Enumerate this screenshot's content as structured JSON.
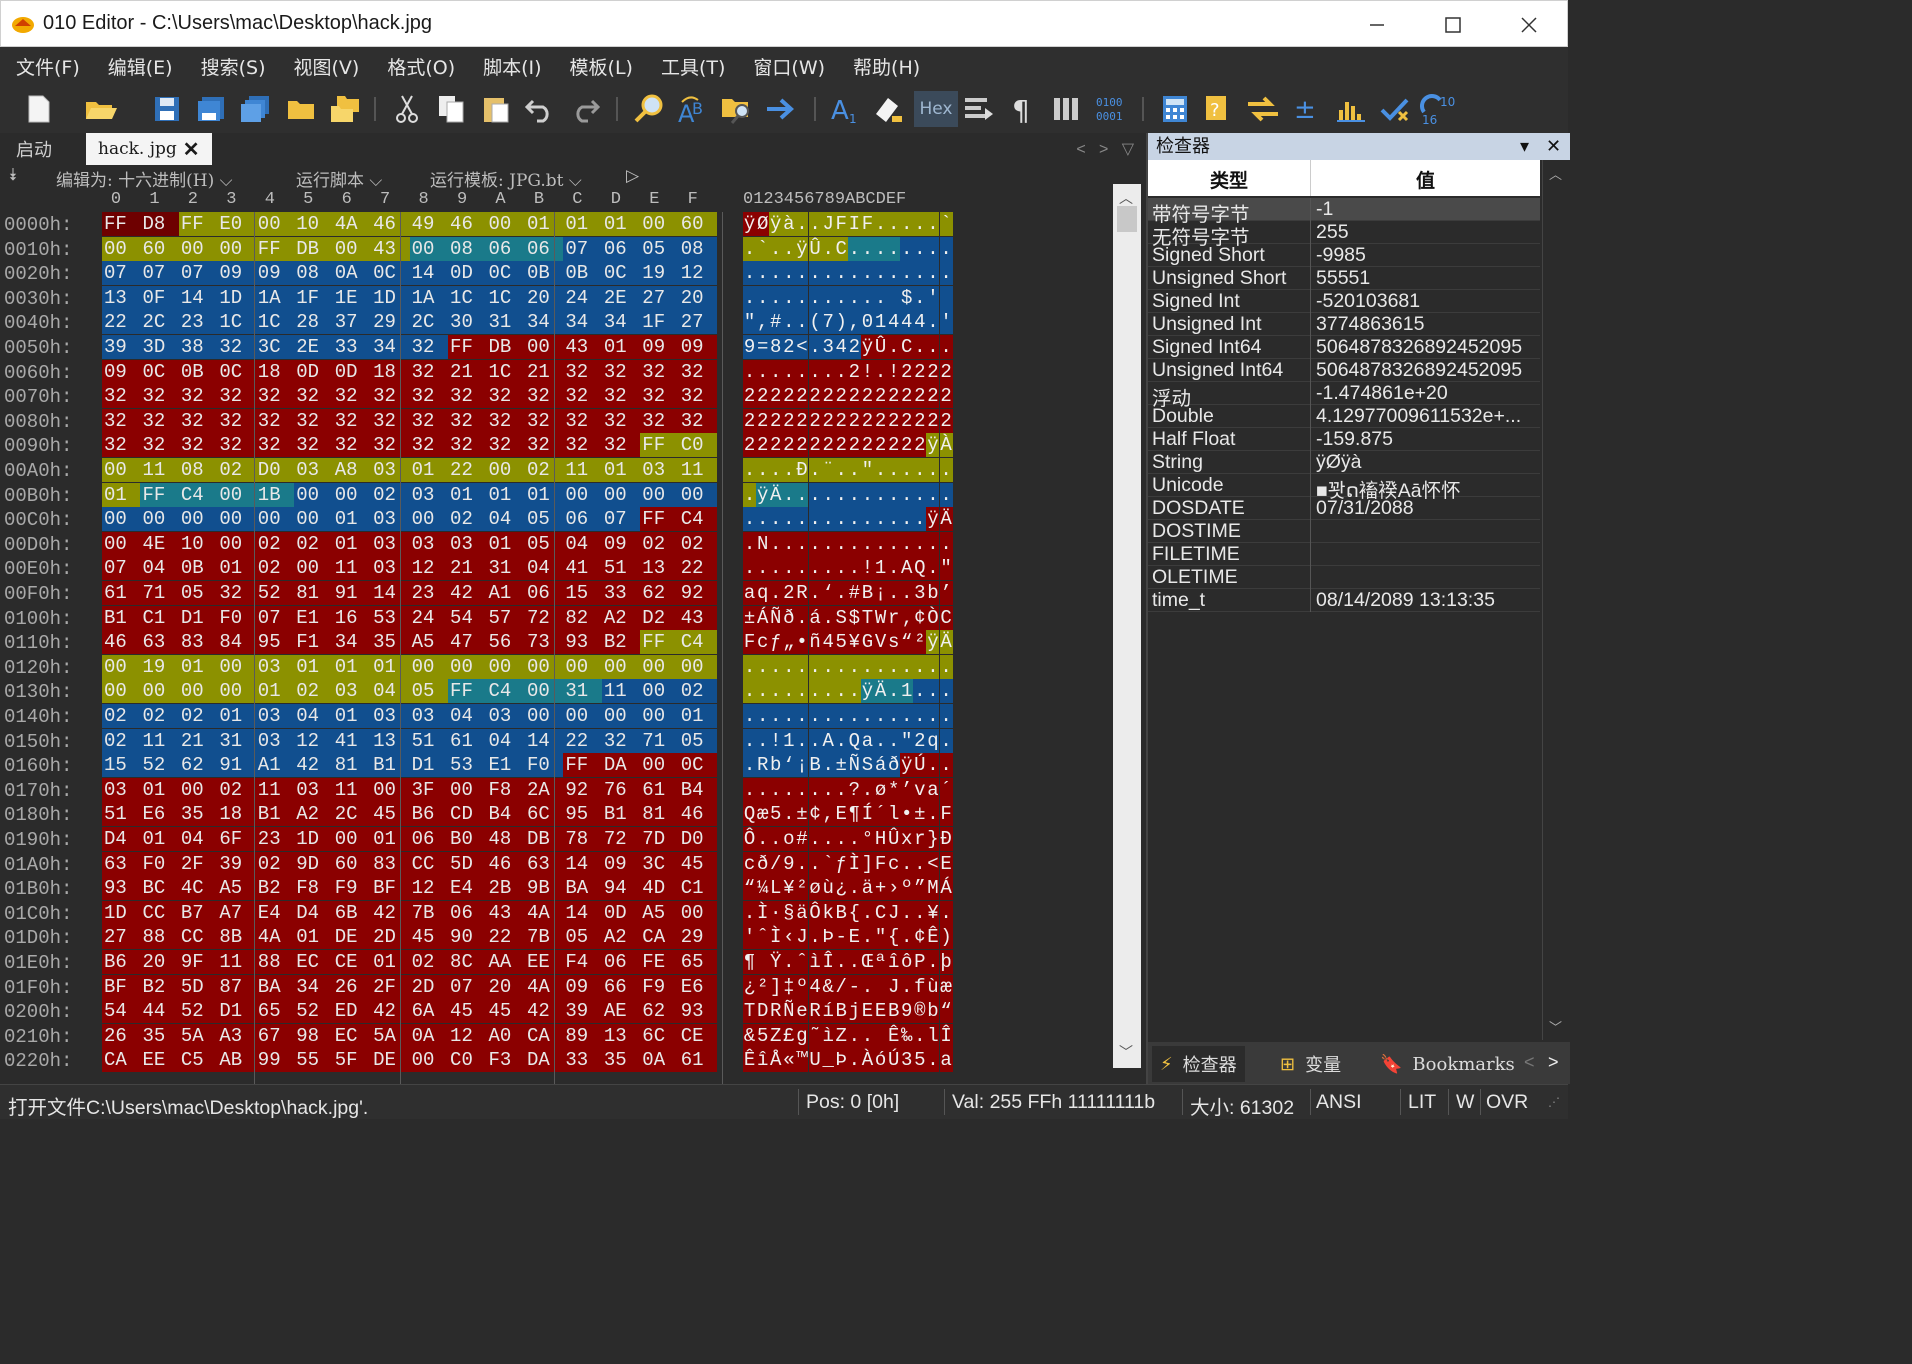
{
  "window": {
    "title": "010 Editor - C:\\Users\\mac\\Desktop\\hack.jpg",
    "minimize_glyph": "—",
    "maximize_glyph": "☐",
    "close_glyph": "✕"
  },
  "menu": [
    "文件(F)",
    "编辑(E)",
    "搜索(S)",
    "视图(V)",
    "格式(O)",
    "脚本(I)",
    "模板(L)",
    "工具(T)",
    "窗口(W)",
    "帮助(H)"
  ],
  "toolbar": {
    "hex_label": "Hex",
    "icons": [
      "new-file-icon",
      "open-folder-icon",
      "save-icon",
      "save-as-icon",
      "save-all-icon",
      "open-folder-2-icon",
      "open-multiple-icon",
      "cut-icon",
      "copy-icon",
      "paste-icon",
      "undo-icon",
      "redo-icon",
      "find-icon",
      "replace-icon",
      "find-in-files-icon",
      "goto-icon",
      "font-icon",
      "highlight-icon",
      "hex-mode-icon",
      "edit-as-icon",
      "paragraph-icon",
      "columns-icon",
      "binary-icon",
      "calculator-icon",
      "lookup-icon",
      "compare-icon",
      "checksum-icon",
      "histogram-icon",
      "check-icon",
      "convert-icon"
    ]
  },
  "tabs": {
    "start": "启动",
    "file": "hack. jpg",
    "close": "✕"
  },
  "editor_header": {
    "edit_as": "编辑为: 十六进制(H) ⌵",
    "run_script": "运行脚本 ⌵",
    "run_template": "运行模板: JPG.bt ⌵",
    "play": "▷"
  },
  "columns": [
    "0",
    "1",
    "2",
    "3",
    "4",
    "5",
    "6",
    "7",
    "8",
    "9",
    "A",
    "B",
    "C",
    "D",
    "E",
    "F"
  ],
  "ascii_header": "0123456789ABCDEF",
  "hex_rows": [
    {
      "addr": "0000h:",
      "hex": "FF D8 FF E0 00 10 4A 46 49 46 00 01 01 01 00 60",
      "ascii": "ÿØÿà..JFIF.....`"
    },
    {
      "addr": "0010h:",
      "hex": "00 60 00 00 FF DB 00 43 00 08 06 06 07 06 05 08",
      "ascii": ".`..ÿÛ.C........"
    },
    {
      "addr": "0020h:",
      "hex": "07 07 07 09 09 08 0A 0C 14 0D 0C 0B 0B 0C 19 12",
      "ascii": "................"
    },
    {
      "addr": "0030h:",
      "hex": "13 0F 14 1D 1A 1F 1E 1D 1A 1C 1C 20 24 2E 27 20",
      "ascii": "........... $.' "
    },
    {
      "addr": "0040h:",
      "hex": "22 2C 23 1C 1C 28 37 29 2C 30 31 34 34 34 1F 27",
      "ascii": "\",#..(7),01444.'"
    },
    {
      "addr": "0050h:",
      "hex": "39 3D 38 32 3C 2E 33 34 32 FF DB 00 43 01 09 09",
      "ascii": "9=82<.342ÿÛ.C..."
    },
    {
      "addr": "0060h:",
      "hex": "09 0C 0B 0C 18 0D 0D 18 32 21 1C 21 32 32 32 32",
      "ascii": "........2!.!2222"
    },
    {
      "addr": "0070h:",
      "hex": "32 32 32 32 32 32 32 32 32 32 32 32 32 32 32 32",
      "ascii": "2222222222222222"
    },
    {
      "addr": "0080h:",
      "hex": "32 32 32 32 32 32 32 32 32 32 32 32 32 32 32 32",
      "ascii": "2222222222222222"
    },
    {
      "addr": "0090h:",
      "hex": "32 32 32 32 32 32 32 32 32 32 32 32 32 32 FF C0",
      "ascii": "22222222222222ÿÀ"
    },
    {
      "addr": "00A0h:",
      "hex": "00 11 08 02 D0 03 A8 03 01 22 00 02 11 01 03 11",
      "ascii": "....Ð.¨..\"......"
    },
    {
      "addr": "00B0h:",
      "hex": "01 FF C4 00 1B 00 00 02 03 01 01 01 00 00 00 00",
      "ascii": ".ÿÄ............."
    },
    {
      "addr": "00C0h:",
      "hex": "00 00 00 00 00 00 01 03 00 02 04 05 06 07 FF C4",
      "ascii": "..............ÿÄ"
    },
    {
      "addr": "00D0h:",
      "hex": "00 4E 10 00 02 02 01 03 03 03 01 05 04 09 02 02",
      "ascii": ".N.............."
    },
    {
      "addr": "00E0h:",
      "hex": "07 04 0B 01 02 00 11 03 12 21 31 04 41 51 13 22",
      "ascii": ".........!1.AQ.\""
    },
    {
      "addr": "00F0h:",
      "hex": "61 71 05 32 52 81 91 14 23 42 A1 06 15 33 62 92",
      "ascii": "aq.2R.‘.#B¡..3b’"
    },
    {
      "addr": "0100h:",
      "hex": "B1 C1 D1 F0 07 E1 16 53 24 54 57 72 82 A2 D2 43",
      "ascii": "±ÁÑð.á.S$TWr‚¢ÒC"
    },
    {
      "addr": "0110h:",
      "hex": "46 63 83 84 95 F1 34 35 A5 47 56 73 93 B2 FF C4",
      "ascii": "Fcƒ„•ñ45¥GVs“²ÿÄ"
    },
    {
      "addr": "0120h:",
      "hex": "00 19 01 00 03 01 01 01 00 00 00 00 00 00 00 00",
      "ascii": "................"
    },
    {
      "addr": "0130h:",
      "hex": "00 00 00 00 01 02 03 04 05 FF C4 00 31 11 00 02",
      "ascii": ".........ÿÄ.1..."
    },
    {
      "addr": "0140h:",
      "hex": "02 02 02 01 03 04 01 03 03 04 03 00 00 00 00 01",
      "ascii": "................"
    },
    {
      "addr": "0150h:",
      "hex": "02 11 21 31 03 12 41 13 51 61 04 14 22 32 71 05",
      "ascii": "..!1..A.Qa..\"2q."
    },
    {
      "addr": "0160h:",
      "hex": "15 52 62 91 A1 42 81 B1 D1 53 E1 F0 FF DA 00 0C",
      "ascii": ".Rb‘¡B.±ÑSáðÿÚ.."
    },
    {
      "addr": "0170h:",
      "hex": "03 01 00 02 11 03 11 00 3F 00 F8 2A 92 76 61 B4",
      "ascii": "........?.ø*’va´"
    },
    {
      "addr": "0180h:",
      "hex": "51 E6 35 18 B1 A2 2C 45 B6 CD B4 6C 95 B1 81 46",
      "ascii": "Qæ5.±¢,E¶Í´l•±.F"
    },
    {
      "addr": "0190h:",
      "hex": "D4 01 04 6F 23 1D 00 01 06 B0 48 DB 78 72 7D D0",
      "ascii": "Ô..o#....°HÛxr}Ð"
    },
    {
      "addr": "01A0h:",
      "hex": "63 F0 2F 39 02 9D 60 83 CC 5D 46 63 14 09 3C 45",
      "ascii": "cð/9..`ƒÌ]Fc..<E"
    },
    {
      "addr": "01B0h:",
      "hex": "93 BC 4C A5 B2 F8 F9 BF 12 E4 2B 9B BA 94 4D C1",
      "ascii": "“¼L¥²øù¿.ä+›º”MÁ"
    },
    {
      "addr": "01C0h:",
      "hex": "1D CC B7 A7 E4 D4 6B 42 7B 06 43 4A 14 0D A5 00",
      "ascii": ".Ì·§äÔkB{.CJ..¥."
    },
    {
      "addr": "01D0h:",
      "hex": "27 88 CC 8B 4A 01 DE 2D 45 90 22 7B 05 A2 CA 29",
      "ascii": "'ˆÌ‹J.Þ-E.\"{.¢Ê)"
    },
    {
      "addr": "01E0h:",
      "hex": "B6 20 9F 11 88 EC CE 01 02 8C AA EE F4 06 FE 65",
      "ascii": "¶ Ÿ.ˆìÎ..ŒªîôP.þe"
    },
    {
      "addr": "01F0h:",
      "hex": "BF B2 5D 87 BA 34 26 2F 2D 07 20 4A 09 66 F9 E6",
      "ascii": "¿²]‡º4&/-. J.fùæ"
    },
    {
      "addr": "0200h:",
      "hex": "54 44 52 D1 65 52 ED 42 6A 45 45 42 39 AE 62 93",
      "ascii": "TDRÑeRíBjEEB9®b“"
    },
    {
      "addr": "0210h:",
      "hex": "26 35 5A A3 67 98 EC 5A 0A 12 A0 CA 89 13 6C CE",
      "ascii": "&5Z£g˜ìZ.. Ê‰.lÎ"
    },
    {
      "addr": "0220h:",
      "hex": "CA EE C5 AB 99 55 5F DE 00 C0 F3 DA 33 35 0A 61",
      "ascii": "ÊîÅ«™U_Þ.ÀóÚ35.a"
    }
  ],
  "colors": {
    "red": "#8b0000",
    "olive": "#8c9100",
    "blue": "#114f8f",
    "teal": "#1a7a8a",
    "darkred": "#5a0000"
  },
  "inspector": {
    "title": "检查器",
    "col_type": "类型",
    "col_value": "值",
    "rows": [
      {
        "type": "带符号字节",
        "value": "-1"
      },
      {
        "type": "无符号字节",
        "value": "255"
      },
      {
        "type": "Signed Short",
        "value": "-9985"
      },
      {
        "type": "Unsigned Short",
        "value": "55551"
      },
      {
        "type": "Signed Int",
        "value": "-520103681"
      },
      {
        "type": "Unsigned Int",
        "value": "3774863615"
      },
      {
        "type": "Signed Int64",
        "value": "5064878326892452095"
      },
      {
        "type": "Unsigned Int64",
        "value": "5064878326892452095"
      },
      {
        "type": "浮动",
        "value": "-1.474861e+20"
      },
      {
        "type": "Double",
        "value": "4.12977009611532e+..."
      },
      {
        "type": "Half Float",
        "value": "-159.875"
      },
      {
        "type": "String",
        "value": "ÿØÿà"
      },
      {
        "type": "Unicode",
        "value": "■꽛ດ䙒䙆Aā怀怀"
      },
      {
        "type": "DOSDATE",
        "value": "07/31/2088"
      },
      {
        "type": "DOSTIME",
        "value": ""
      },
      {
        "type": "FILETIME",
        "value": ""
      },
      {
        "type": "OLETIME",
        "value": ""
      },
      {
        "type": "time_t",
        "value": "08/14/2089 13:13:35"
      }
    ],
    "tabs": [
      "检查器",
      "变量",
      "Bookmarks"
    ]
  },
  "status": {
    "message": "打开文件C:\\Users\\mac\\Desktop\\hack.jpg'.",
    "pos": "Pos: 0 [0h]",
    "val": "Val: 255 FFh 11111111b",
    "size": "大小: 61302",
    "encoding": "ANSI",
    "endian": "LIT",
    "w": "W",
    "mode": "OVR"
  }
}
